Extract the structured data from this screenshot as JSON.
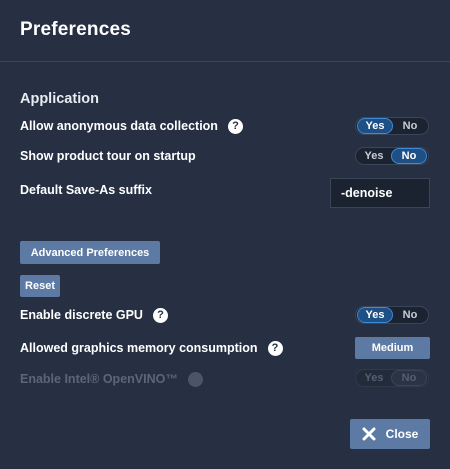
{
  "dialog": {
    "title": "Preferences"
  },
  "application": {
    "heading": "Application",
    "anonymous_data": {
      "label": "Allow anonymous data collection",
      "yes": "Yes",
      "no": "No",
      "selected": "Yes"
    },
    "product_tour": {
      "label": "Show product tour on startup",
      "yes": "Yes",
      "no": "No",
      "selected": "No"
    },
    "save_as_suffix": {
      "label": "Default Save-As suffix",
      "value": "-denoise"
    }
  },
  "buttons": {
    "advanced": "Advanced Preferences",
    "reset": "Reset",
    "close": "Close"
  },
  "gpu": {
    "discrete_gpu": {
      "label": "Enable discrete GPU",
      "yes": "Yes",
      "no": "No",
      "selected": "Yes"
    },
    "memory": {
      "label": "Allowed graphics memory consumption",
      "value": "Medium"
    },
    "openvino": {
      "label": "Enable Intel® OpenVINO™",
      "yes": "Yes",
      "no": "No",
      "selected": "No",
      "disabled": true
    }
  },
  "icons": {
    "help": "question-mark-icon",
    "close": "x-icon"
  },
  "colors": {
    "background": "#263042",
    "toggle_active": "#1e4f85",
    "toggle_active_border": "#3e8ad6",
    "button": "#5d7aa5"
  }
}
